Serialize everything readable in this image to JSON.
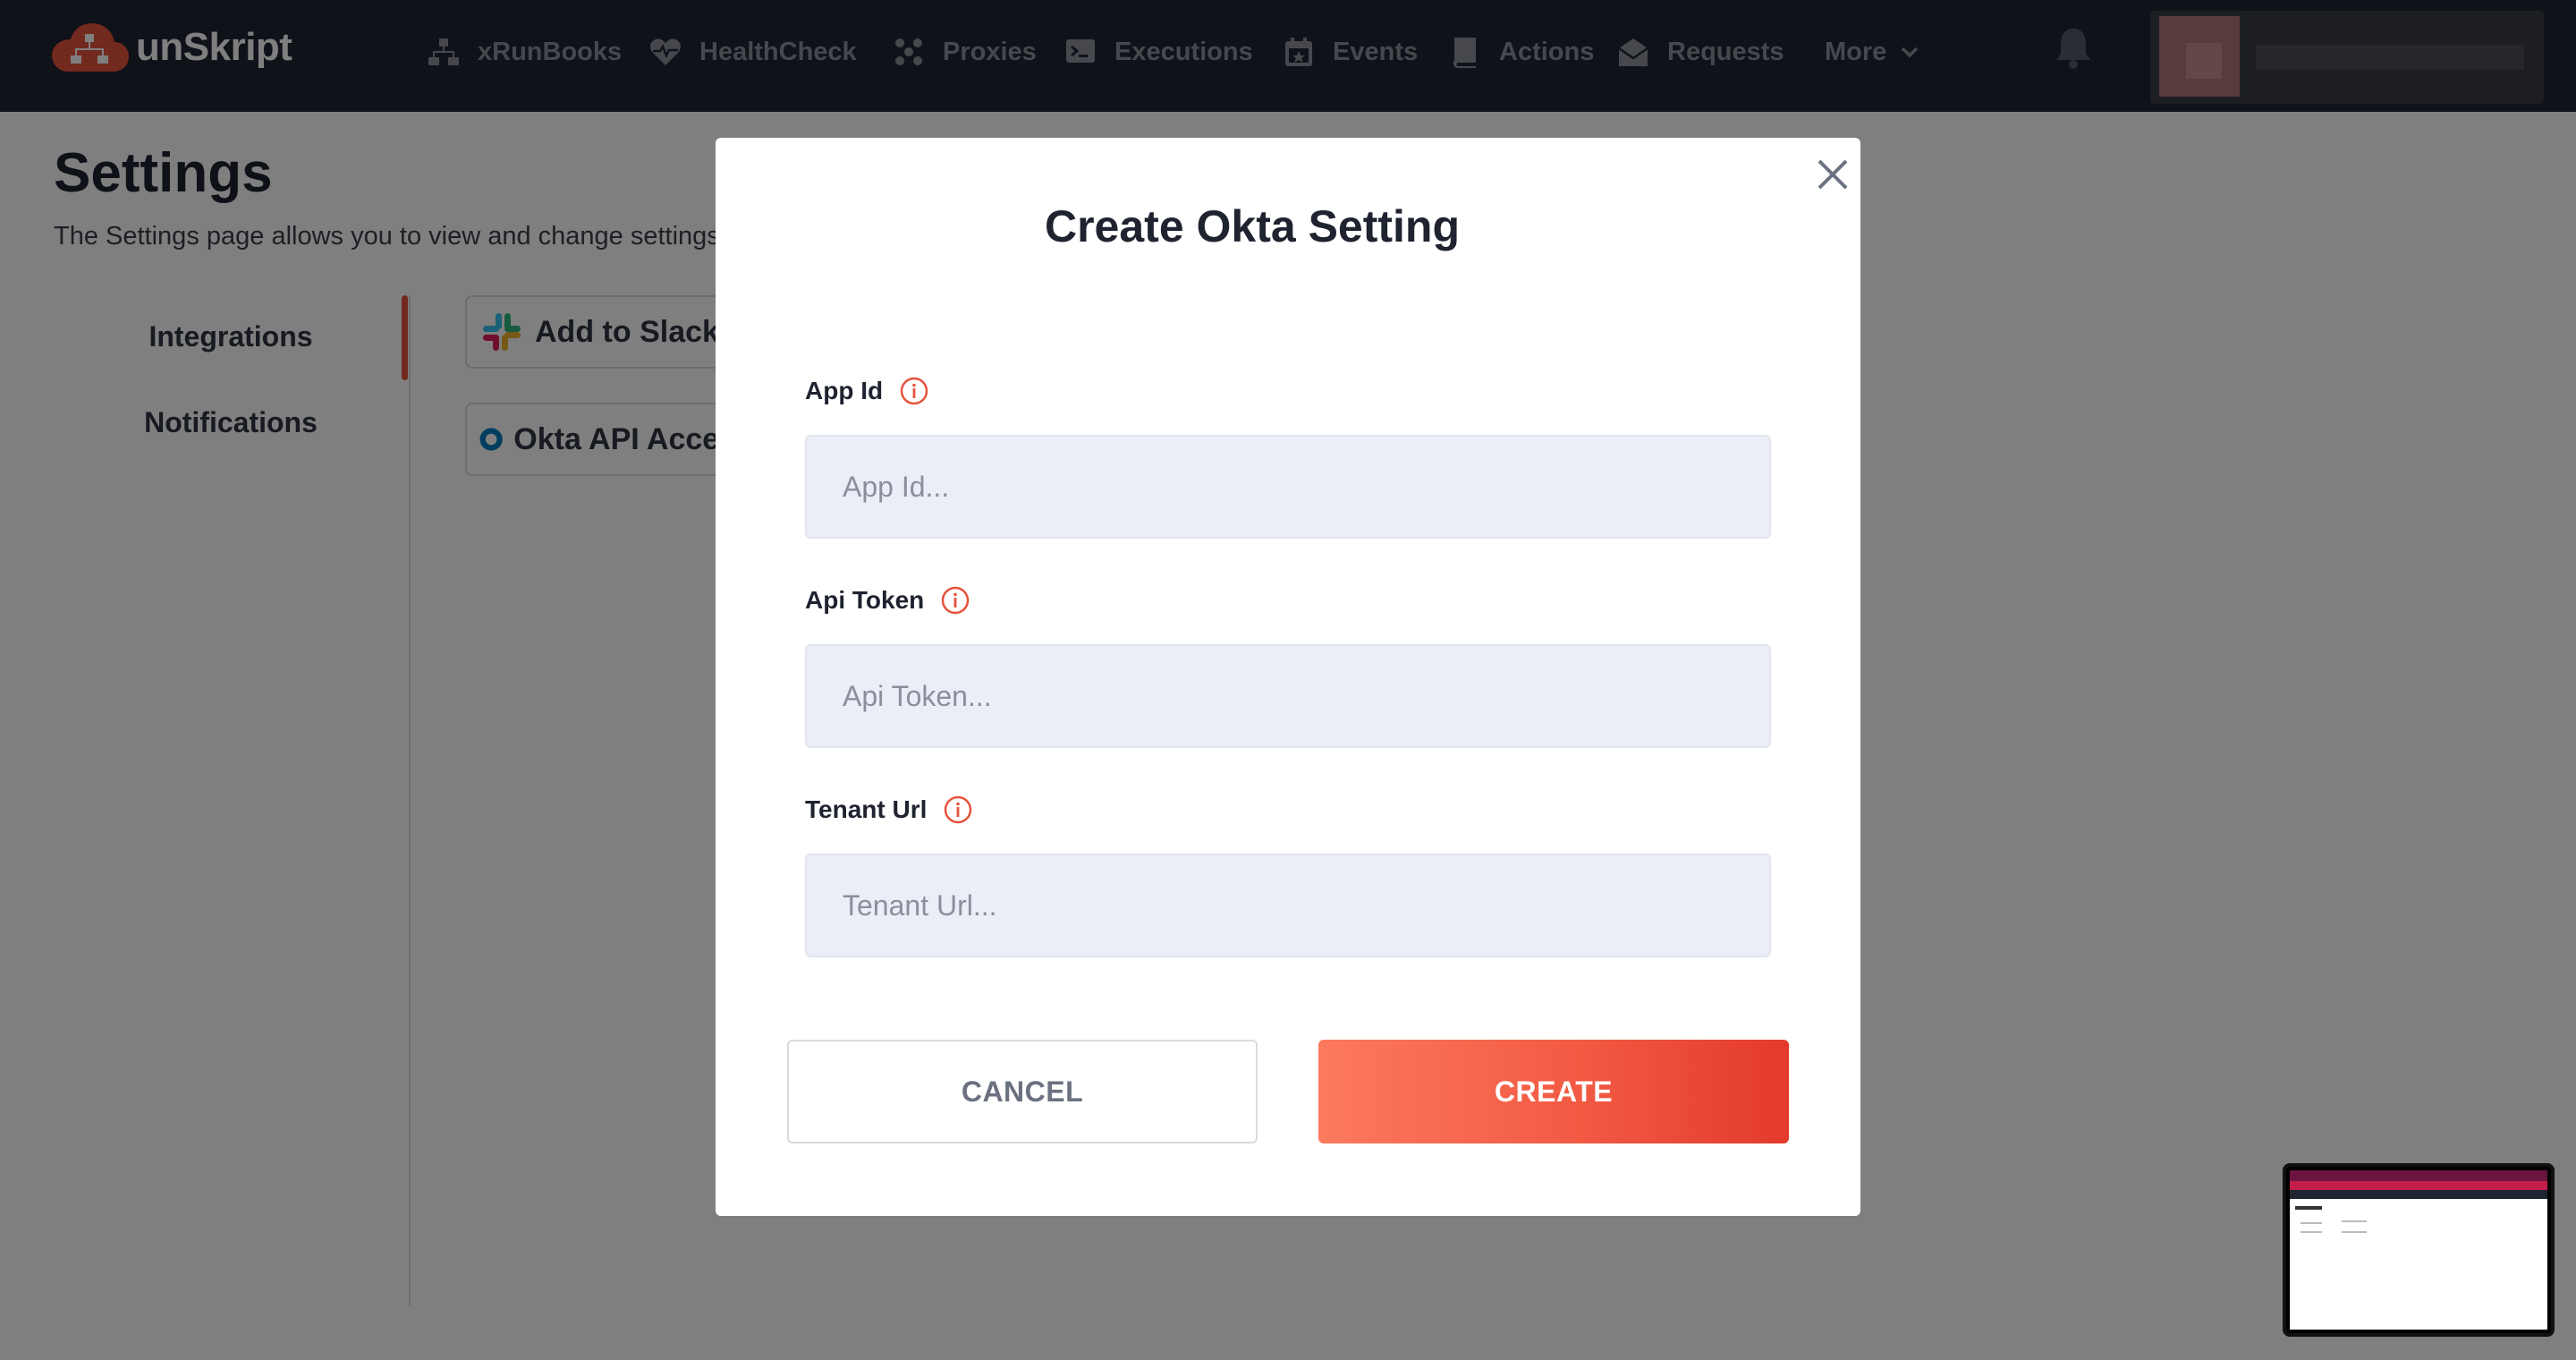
{
  "app": {
    "name": "unSkript",
    "brand_color": "#e5533d",
    "nav_bg": "#1f2431"
  },
  "nav": {
    "items": [
      {
        "label": "xRunBooks",
        "icon": "sitemap-icon"
      },
      {
        "label": "HealthCheck",
        "icon": "heartbeat-icon"
      },
      {
        "label": "Proxies",
        "icon": "cluster-icon"
      },
      {
        "label": "Executions",
        "icon": "terminal-icon"
      },
      {
        "label": "Events",
        "icon": "calendar-icon"
      },
      {
        "label": "Actions",
        "icon": "book-icon"
      },
      {
        "label": "Requests",
        "icon": "envelope-icon"
      }
    ],
    "more_label": "More",
    "notifications_icon": "bell-icon"
  },
  "page": {
    "title": "Settings",
    "subtitle": "The Settings page allows you to view and change settings",
    "tabs": [
      "Integrations",
      "Notifications"
    ],
    "active_tab": "Integrations",
    "integrations": [
      {
        "label": "Add to Slack",
        "icon": "slack-icon"
      },
      {
        "label": "Okta API Access",
        "icon": "okta-icon"
      }
    ]
  },
  "modal": {
    "title": "Create Okta Setting",
    "close_icon": "close-icon",
    "fields": [
      {
        "label": "App Id",
        "placeholder": "App Id...",
        "value": ""
      },
      {
        "label": "Api Token",
        "placeholder": "Api Token...",
        "value": ""
      },
      {
        "label": "Tenant Url",
        "placeholder": "Tenant Url...",
        "value": ""
      }
    ],
    "cancel_label": "CANCEL",
    "create_label": "CREATE"
  }
}
